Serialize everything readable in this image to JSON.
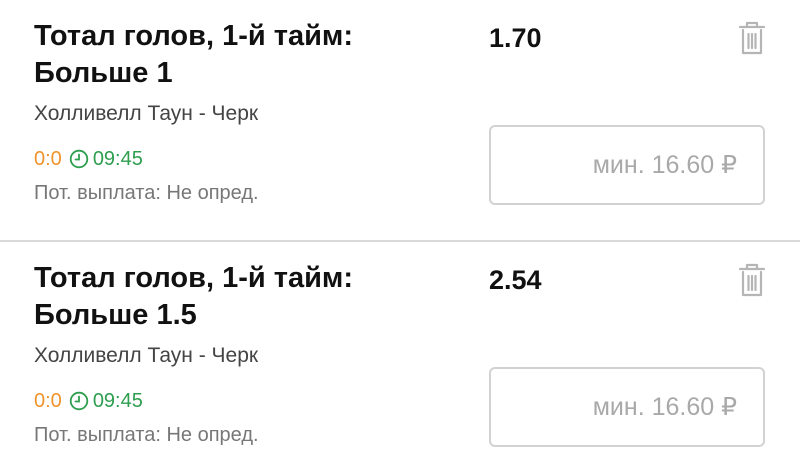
{
  "bets": [
    {
      "market": "Тотал голов, 1-й тайм: Больше 1",
      "odds": "1.70",
      "match": "Холливелл Таун - Черк",
      "score": "0:0",
      "time": "09:45",
      "payout": "Пот. выплата: Не опред.",
      "stake_placeholder": "мин. 16.60 ₽"
    },
    {
      "market": "Тотал голов, 1-й тайм: Больше 1.5",
      "odds": "2.54",
      "match": "Холливелл Таун - Черк",
      "score": "0:0",
      "time": "09:45",
      "payout": "Пот. выплата: Не опред.",
      "stake_placeholder": "мин. 16.60 ₽"
    }
  ],
  "colors": {
    "score": "#f0932b",
    "time": "#2e9e4f",
    "trash_icon": "#b5b5b5",
    "divider": "#d9d9d9"
  },
  "icons": {
    "delete": "trash-icon",
    "timer": "clock-icon"
  }
}
